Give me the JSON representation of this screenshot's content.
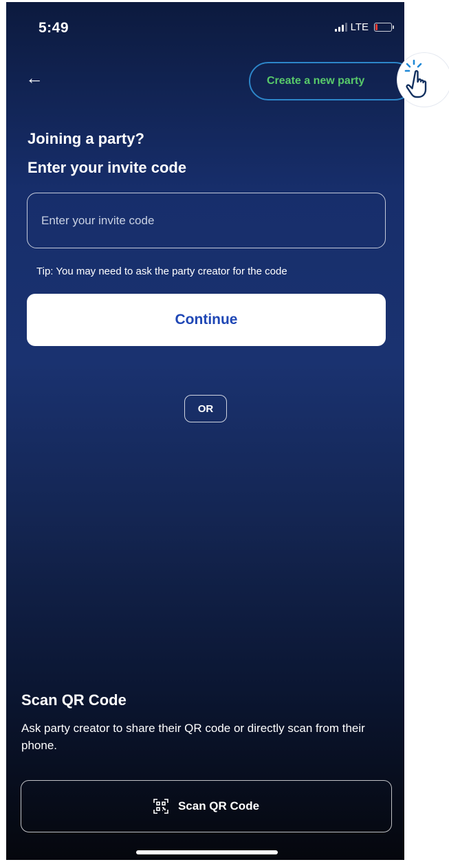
{
  "status_bar": {
    "time": "5:49",
    "network": "LTE"
  },
  "header": {
    "back_icon": "back-arrow-icon",
    "create_party_label": "Create a new party"
  },
  "join": {
    "title_line1": "Joining a party?",
    "title_line2": "Enter your invite code",
    "input_placeholder": "Enter your invite code",
    "tip": "Tip: You may need to ask the party creator for the code",
    "continue_label": "Continue"
  },
  "divider": {
    "or_label": "OR"
  },
  "scan": {
    "title": "Scan QR Code",
    "description": "Ask party creator to share their QR code or directly scan from their phone.",
    "button_label": "Scan QR Code",
    "button_icon": "qr-code-icon"
  },
  "overlay": {
    "icon": "tap-hand-icon"
  },
  "colors": {
    "accent_green": "#58c96a",
    "outline_blue": "#2d86c9",
    "continue_text": "#1f47b5",
    "bg_top": "#0c1a3e",
    "bg_mid": "#1a3270",
    "bg_bottom": "#05070d"
  }
}
